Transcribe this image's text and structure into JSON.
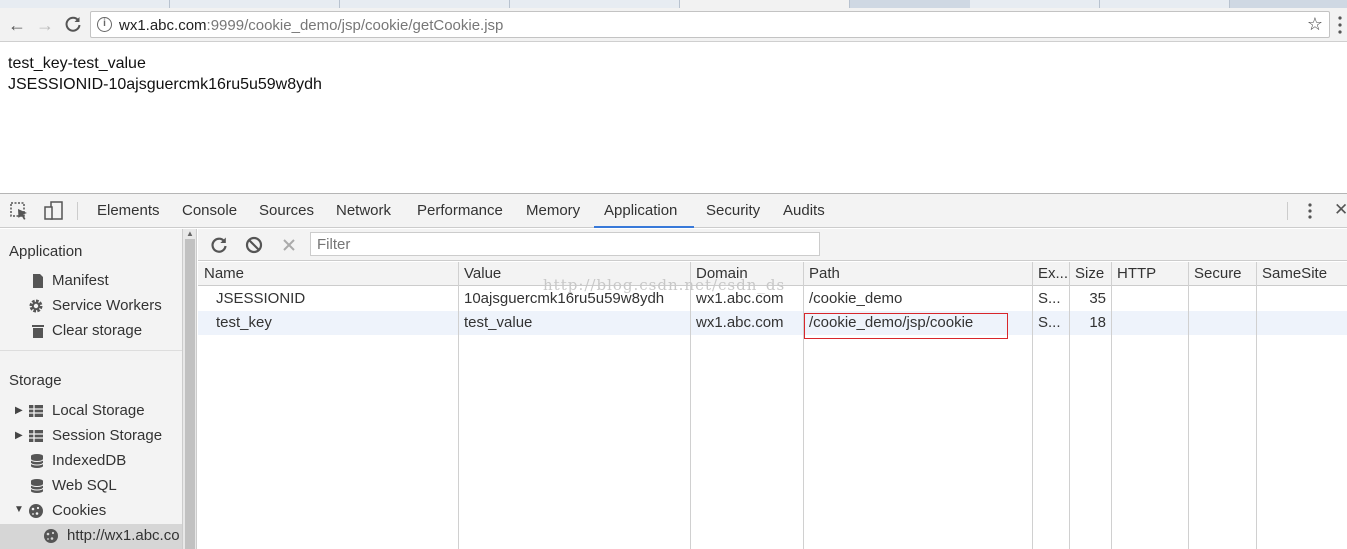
{
  "browser": {
    "url_host": "wx1.abc.com",
    "url_rest": ":9999/cookie_demo/jsp/cookie/getCookie.jsp"
  },
  "page": {
    "lines": [
      "test_key-test_value",
      "JSESSIONID-10ajsguercmk16ru5u59w8ydh"
    ]
  },
  "devtools": {
    "tabs": [
      "Elements",
      "Console",
      "Sources",
      "Network",
      "Performance",
      "Memory",
      "Application",
      "Security",
      "Audits"
    ],
    "active_tab": "Application",
    "sidebar": {
      "application_title": "Application",
      "application_items": [
        "Manifest",
        "Service Workers",
        "Clear storage"
      ],
      "storage_title": "Storage",
      "storage_items": [
        "Local Storage",
        "Session Storage",
        "IndexedDB",
        "Web SQL",
        "Cookies"
      ],
      "cookie_origin": "http://wx1.abc.co"
    },
    "filter_placeholder": "Filter",
    "watermark": "http://blog.csdn.net/csdn_ds",
    "columns": [
      "Name",
      "Value",
      "Domain",
      "Path",
      "Ex...",
      "Size",
      "HTTP",
      "Secure",
      "SameSite"
    ],
    "rows": [
      {
        "name": "JSESSIONID",
        "value": "10ajsguercmk16ru5u59w8ydh",
        "domain": "wx1.abc.com",
        "path": "/cookie_demo",
        "expires": "S...",
        "size": "35",
        "http": "",
        "secure": "",
        "samesite": ""
      },
      {
        "name": "test_key",
        "value": "test_value",
        "domain": "wx1.abc.com",
        "path": "/cookie_demo/jsp/cookie",
        "expires": "S...",
        "size": "18",
        "http": "",
        "secure": "",
        "samesite": ""
      }
    ],
    "highlight_color": "#d8262b",
    "accent_color": "#3879d9"
  }
}
